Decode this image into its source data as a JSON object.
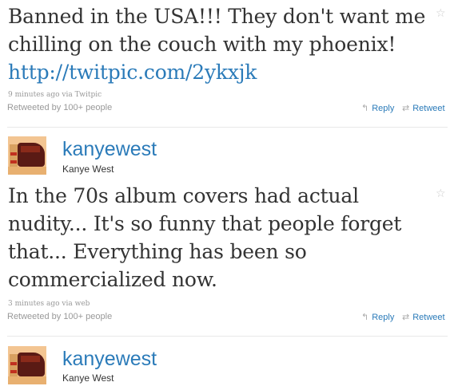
{
  "tweets": [
    {
      "text": "Banned in the USA!!! They don't want me chilling on the couch with my phoenix! ",
      "link": "http://twitpic.com/2ykxjk",
      "meta": "9 minutes ago via Twitpic",
      "retweeted_by": "Retweeted by 100+ people",
      "reply_label": "Reply",
      "retweet_label": "Retweet",
      "favorite_icon": "star-icon"
    },
    {
      "username": "kanyewest",
      "fullname": "Kanye West",
      "text": "In the 70s album covers had actual nudity... It's so funny that people forget that... Everything has been so commercialized now.",
      "meta": "3 minutes ago via web",
      "retweeted_by": "Retweeted by 100+ people",
      "reply_label": "Reply",
      "retweet_label": "Retweet",
      "favorite_icon": "star-icon"
    },
    {
      "username": "kanyewest",
      "fullname": "Kanye West"
    }
  ],
  "icons": {
    "reply": "reply-arrow-icon",
    "retweet": "retweet-icon",
    "star": "star-icon"
  },
  "colors": {
    "link": "#2b7bb9",
    "text": "#333333",
    "muted": "#999999"
  }
}
